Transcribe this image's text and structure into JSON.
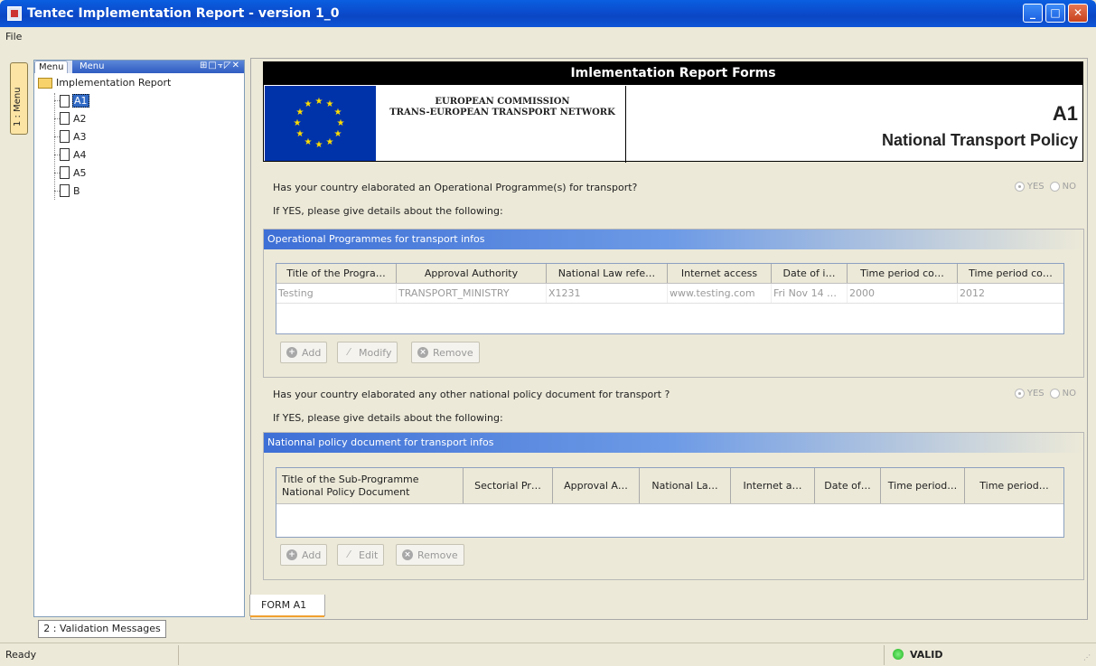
{
  "window": {
    "title": "Tentec Implementation Report - version 1_0"
  },
  "menubar": {
    "file": "File"
  },
  "sidebar": {
    "vertical_tab": "1 : Menu",
    "tabs": [
      "Menu",
      "Menu"
    ],
    "icons_text": "⊞□⫟◸✕",
    "root": "Implementation Report",
    "items": [
      {
        "label": "A1",
        "selected": true
      },
      {
        "label": "A2"
      },
      {
        "label": "A3"
      },
      {
        "label": "A4"
      },
      {
        "label": "A5"
      },
      {
        "label": "B"
      }
    ],
    "bottom_tab": "2 : Validation Messages"
  },
  "header": {
    "title": "Imlementation Report Forms",
    "org_line1": "EUROPEAN COMMISSION",
    "org_line2": "TRANS-EUROPEAN TRANSPORT NETWORK",
    "form_code": "A1",
    "form_name": "National Transport Policy"
  },
  "section1": {
    "question": "Has your country elaborated an Operational Programme(s) for transport?",
    "yes": "YES",
    "no": "NO",
    "selected": "YES",
    "details": "If YES, please give details about the following:",
    "group_title": "Operational Programmes for transport infos",
    "columns": [
      "Title of the Progra…",
      "Approval Authority",
      "National Law refe…",
      "Internet access",
      "Date of i…",
      "Time period co…",
      "Time period co…"
    ],
    "rows": [
      [
        "Testing",
        "TRANSPORT_MINISTRY",
        "X1231",
        "www.testing.com",
        "Fri Nov 14 …",
        "2000",
        "2012"
      ]
    ],
    "buttons": {
      "add": "Add",
      "modify": "Modify",
      "remove": "Remove"
    }
  },
  "section2": {
    "question": "Has your country elaborated any other national policy document for transport ?",
    "yes": "YES",
    "no": "NO",
    "selected": "YES",
    "details": "If YES, please give details about the following:",
    "group_title": "Nationnal policy document for transport infos",
    "columns": [
      "Title of the Sub-Programme\nNational Policy Document",
      "Sectorial Pr…",
      "Approval A…",
      "National La…",
      "Internet a…",
      "Date of…",
      "Time period…",
      "Time period…"
    ],
    "buttons": {
      "add": "Add",
      "edit": "Edit",
      "remove": "Remove"
    }
  },
  "tabs": {
    "form": "FORM A1"
  },
  "status": {
    "ready": "Ready",
    "valid": "VALID"
  },
  "colors": {
    "accent": "#316ac5",
    "valid": "#1fb31f",
    "titlebar": "#0a5fe0"
  }
}
